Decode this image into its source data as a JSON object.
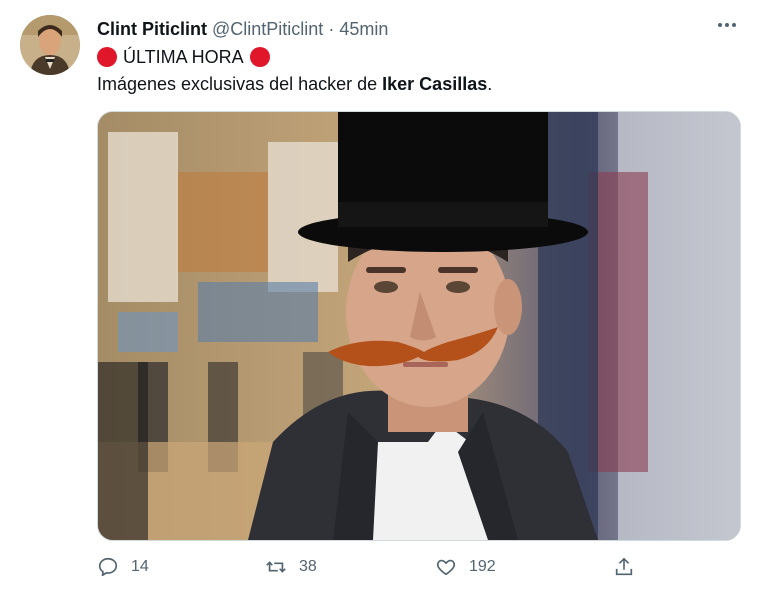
{
  "author": {
    "name": "Clint Piticlint",
    "handle": "@ClintPiticlint",
    "separator": "·",
    "time": "45min"
  },
  "tweet": {
    "line1_text": "ÚLTIMA HORA",
    "line2_prefix": "Imágenes exclusivas del hacker de ",
    "line2_bold": "Iker Casillas",
    "line2_suffix": "."
  },
  "actions": {
    "replies": "14",
    "retweets": "38",
    "likes": "192"
  },
  "icons": {
    "more": "more-dots-icon",
    "reply": "reply-icon",
    "retweet": "retweet-icon",
    "like": "heart-icon",
    "share": "share-icon"
  },
  "colors": {
    "red_dot": "#e0162b",
    "secondary_text": "#536471",
    "mustache": "#b4511a"
  }
}
